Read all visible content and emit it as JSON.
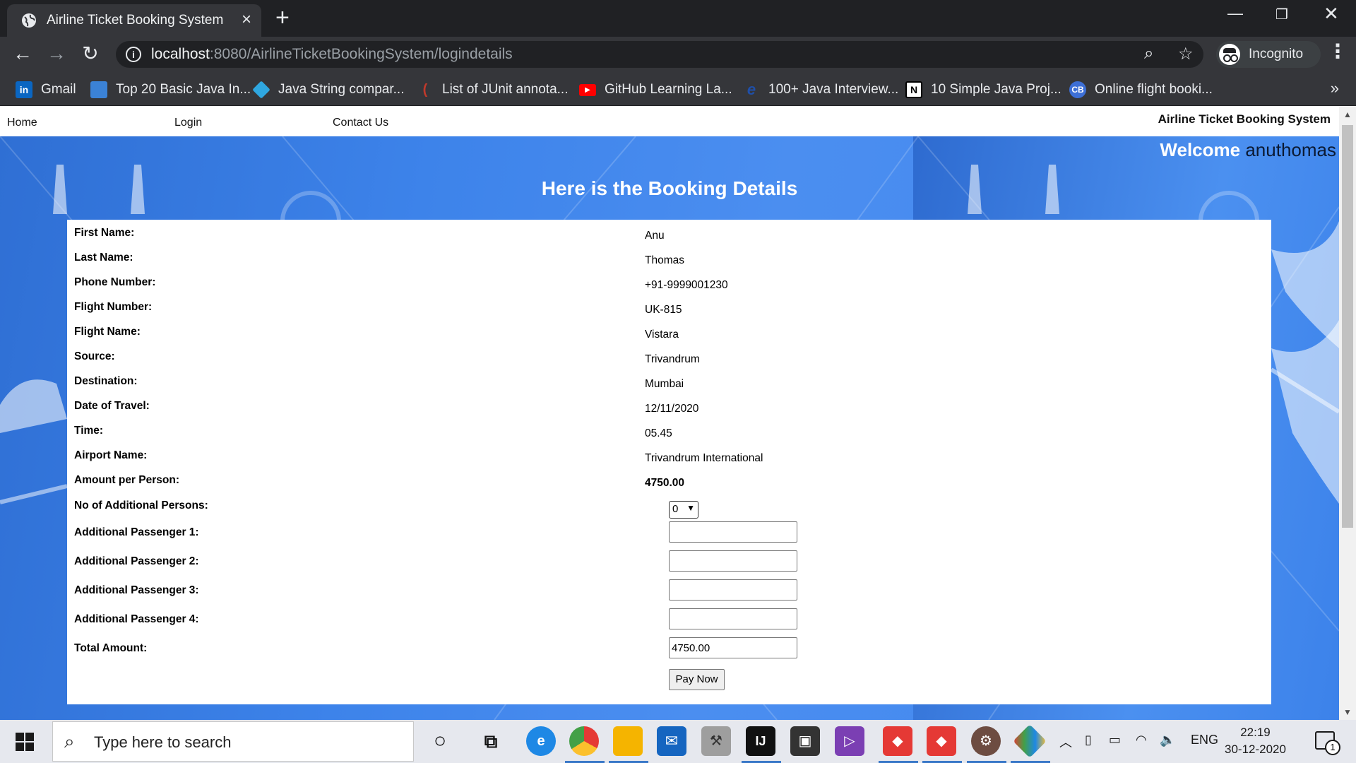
{
  "browser": {
    "tab_title": "Airline Ticket Booking System",
    "url_host": "localhost",
    "url_path": ":8080/AirlineTicketBookingSystem/logindetails",
    "profile_label": "Incognito",
    "bookmarks": [
      {
        "label": "Gmail",
        "icon": "linkedin-icon",
        "color": "#0a66c2"
      },
      {
        "label": "Top 20 Basic Java In...",
        "icon": "page-icon",
        "color": "#3b82d6"
      },
      {
        "label": "Java String compar...",
        "icon": "diamond-icon",
        "color": "#2fa7e0"
      },
      {
        "label": "List of JUnit annota...",
        "icon": "junit-icon",
        "color": "#c0392b"
      },
      {
        "label": "GitHub Learning La...",
        "icon": "youtube-icon",
        "color": "#ff0000"
      },
      {
        "label": "100+ Java Interview...",
        "icon": "edureka-icon",
        "color": "#1f4fa8"
      },
      {
        "label": "10 Simple Java Proj...",
        "icon": "bookmark-icon",
        "color": "#ffffff"
      },
      {
        "label": "Online flight booki...",
        "icon": "cb-icon",
        "color": "#3d6fd6"
      }
    ]
  },
  "page": {
    "nav": {
      "home": "Home",
      "login": "Login",
      "contact": "Contact Us"
    },
    "brand": "Airline Ticket Booking System",
    "welcome_label": "Welcome",
    "username": "anuthomas",
    "heading": "Here is the Booking Details",
    "details": [
      {
        "label": "First Name:",
        "value": "Anu"
      },
      {
        "label": "Last Name:",
        "value": "Thomas"
      },
      {
        "label": "Phone Number:",
        "value": "+91-9999001230"
      },
      {
        "label": "Flight Number:",
        "value": "UK-815"
      },
      {
        "label": "Flight Name:",
        "value": "Vistara"
      },
      {
        "label": "Source:",
        "value": "Trivandrum"
      },
      {
        "label": "Destination:",
        "value": "Mumbai"
      },
      {
        "label": "Date of Travel:",
        "value": "12/11/2020"
      },
      {
        "label": "Time:",
        "value": "05.45"
      },
      {
        "label": "Airport Name:",
        "value": "Trivandrum International"
      },
      {
        "label": "Amount per Person:",
        "value": "4750.00"
      }
    ],
    "additional_persons_label": "No of Additional Persons:",
    "additional_persons_value": "0",
    "passengers": [
      {
        "label": "Additional Passenger 1:",
        "value": ""
      },
      {
        "label": "Additional Passenger 2:",
        "value": ""
      },
      {
        "label": "Additional Passenger 3:",
        "value": ""
      },
      {
        "label": "Additional Passenger 4:",
        "value": ""
      }
    ],
    "total_label": "Total Amount:",
    "total_value": "4750.00",
    "pay_button": "Pay Now"
  },
  "taskbar": {
    "search_placeholder": "Type here to search",
    "language": "ENG",
    "time": "22:19",
    "date": "30-12-2020",
    "notification_count": "1"
  }
}
